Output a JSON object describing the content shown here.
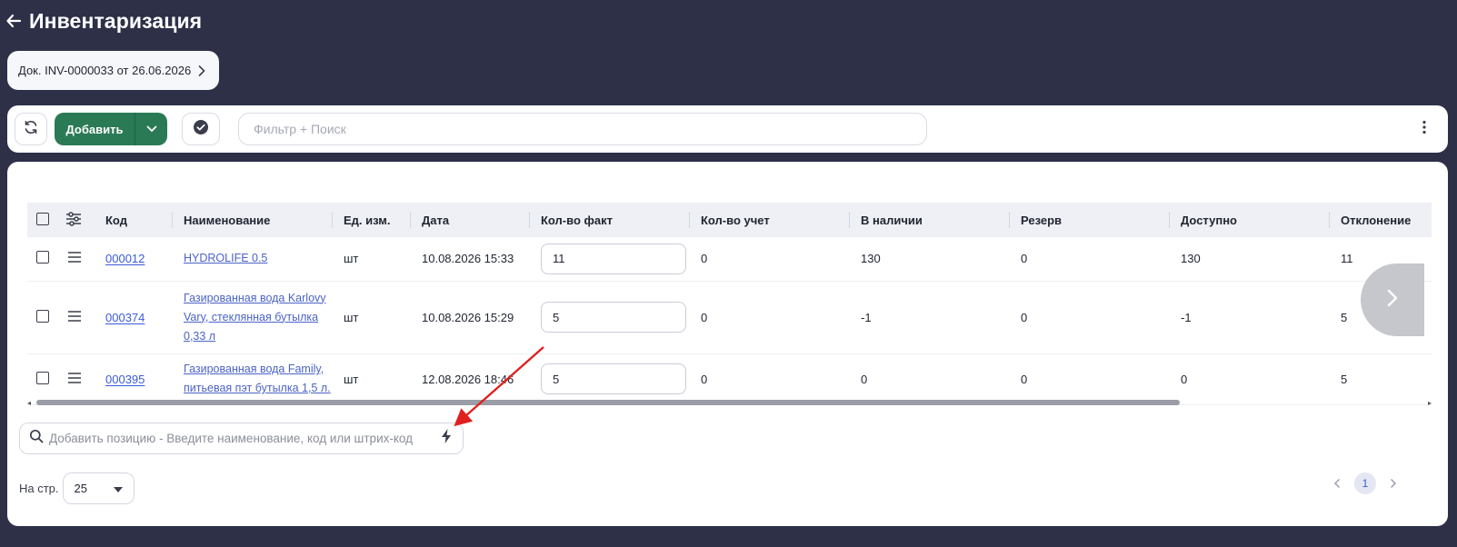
{
  "header": {
    "title": "Инвентаризация"
  },
  "doc": {
    "label": "Док. INV-0000033 от 26.06.2026"
  },
  "toolbar": {
    "add_label": "Добавить",
    "filter_placeholder": "Фильтр + Поиск"
  },
  "table": {
    "columns": [
      "Код",
      "Наименование",
      "Ед. изм.",
      "Дата",
      "Кол-во факт",
      "Кол-во учет",
      "В наличии",
      "Резерв",
      "Доступно",
      "Отклонение"
    ],
    "rows": [
      {
        "code": "000012",
        "name": "HYDROLIFE 0.5",
        "unit": "шт",
        "date": "10.08.2026 15:33",
        "fact": "11",
        "account": "0",
        "stock": "130",
        "reserve": "0",
        "available": "130",
        "deviation": "11"
      },
      {
        "code": "000374",
        "name": "Газированная вода Karlovy Vary, стеклянная бутылка 0,33 л",
        "unit": "шт",
        "date": "10.08.2026 15:29",
        "fact": "5",
        "account": "0",
        "stock": "-1",
        "reserve": "0",
        "available": "-1",
        "deviation": "5"
      },
      {
        "code": "000395",
        "name": "Газированная вода Family, питьевая пэт бутылка 1,5 л.",
        "unit": "шт",
        "date": "12.08.2026 18:46",
        "fact": "5",
        "account": "0",
        "stock": "0",
        "reserve": "0",
        "available": "0",
        "deviation": "5"
      }
    ]
  },
  "add_position": {
    "placeholder": "Добавить позицию - Введите наименование, код или штрих-код"
  },
  "pagination": {
    "per_page_label": "На стр.",
    "per_page_value": "25",
    "current_page": "1"
  },
  "colors": {
    "background": "#2d3047",
    "accent_green": "#2b7a56",
    "link": "#3b5bd6",
    "annotation_arrow": "#e02020"
  }
}
